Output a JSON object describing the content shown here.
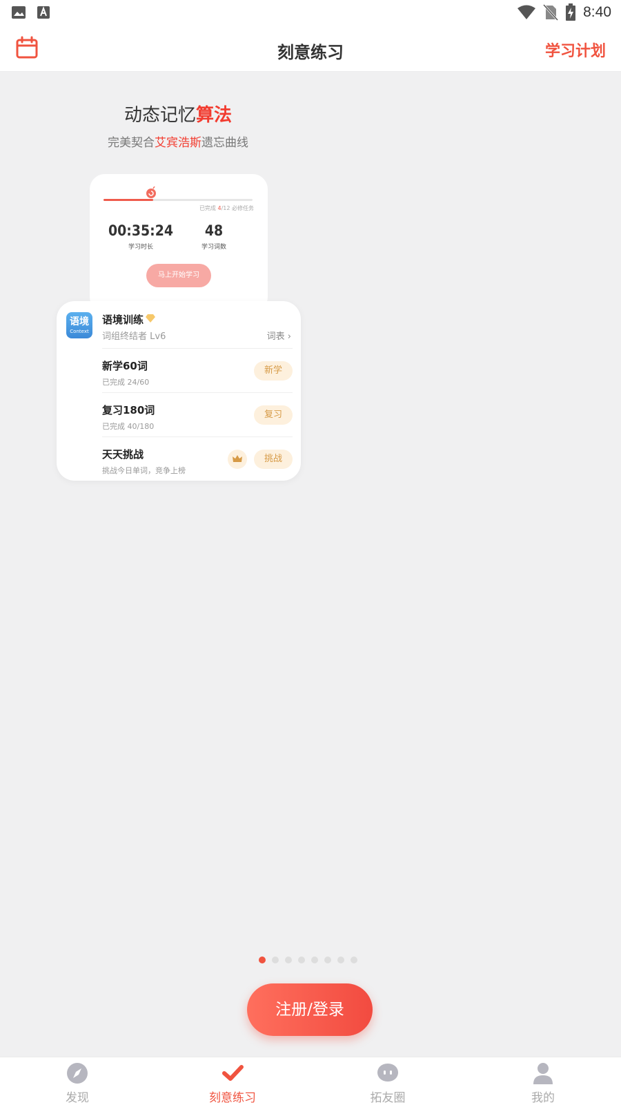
{
  "status_bar": {
    "time": "8:40"
  },
  "header": {
    "title": "刻意练习",
    "plan_link": "学习计划"
  },
  "hero": {
    "title_plain": "动态记忆",
    "title_accent": "算法",
    "sub_pre": "完美契合",
    "sub_accent": "艾宾浩斯",
    "sub_post": "遗忘曲线"
  },
  "progress_card": {
    "progress_pre": "已完成 ",
    "progress_done": "4",
    "progress_post": "/12 必修任务",
    "progress_fraction": 0.333,
    "duration_value": "00:35:24",
    "duration_label": "学习时长",
    "words_value": "48",
    "words_label": "学习词数",
    "start_button": "马上开始学习"
  },
  "task_card": {
    "app_icon_main": "语境",
    "app_icon_sub": "Context",
    "title": "语境训练",
    "level": "词组终结者 Lv6",
    "wordlist_link": "词表 ›",
    "tasks": [
      {
        "title": "新学60词",
        "sub": "已完成 24/60",
        "button": "新学"
      },
      {
        "title": "复习180词",
        "sub": "已完成 40/180",
        "button": "复习"
      },
      {
        "title": "天天挑战",
        "sub": "挑战今日单词，竞争上榜",
        "button": "挑战"
      }
    ]
  },
  "pager": {
    "count": 8,
    "active_index": 0
  },
  "login_button": "注册/登录",
  "bottom_nav": [
    {
      "label": "发现",
      "icon": "compass-icon"
    },
    {
      "label": "刻意练习",
      "icon": "checkmark-icon",
      "active": true
    },
    {
      "label": "拓友圈",
      "icon": "chat-bubble-icon"
    },
    {
      "label": "我的",
      "icon": "person-icon"
    }
  ],
  "colors": {
    "accent": "#f0533f",
    "background": "#f0f0f1",
    "task_button_bg": "#fdf0dd",
    "task_button_text": "#d69a46"
  }
}
